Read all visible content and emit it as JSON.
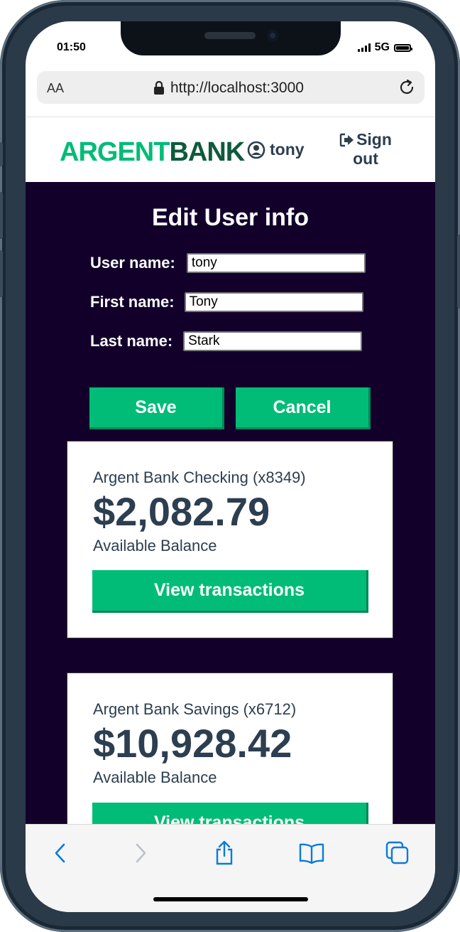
{
  "status": {
    "time": "01:50",
    "network": "5G"
  },
  "browser": {
    "text_size_label": "AA",
    "url": "http://localhost:3000"
  },
  "nav": {
    "logo_part1": "ARGENT",
    "logo_part2": "BANK",
    "username": "tony",
    "signout_line1": "Sign",
    "signout_line2": "out"
  },
  "form": {
    "title": "Edit User info",
    "username_label": "User name:",
    "username_value": "tony",
    "firstname_label": "First name:",
    "firstname_value": "Tony",
    "lastname_label": "Last name:",
    "lastname_value": "Stark",
    "save_label": "Save",
    "cancel_label": "Cancel"
  },
  "accounts": [
    {
      "title": "Argent Bank Checking (x8349)",
      "amount": "$2,082.79",
      "description": "Available Balance",
      "button": "View transactions"
    },
    {
      "title": "Argent Bank Savings (x6712)",
      "amount": "$10,928.42",
      "description": "Available Balance",
      "button": "View transactions"
    }
  ],
  "colors": {
    "accent": "#00bc77",
    "background": "#12002b",
    "text": "#2c3e50",
    "ios_blue": "#0a7bd8"
  }
}
